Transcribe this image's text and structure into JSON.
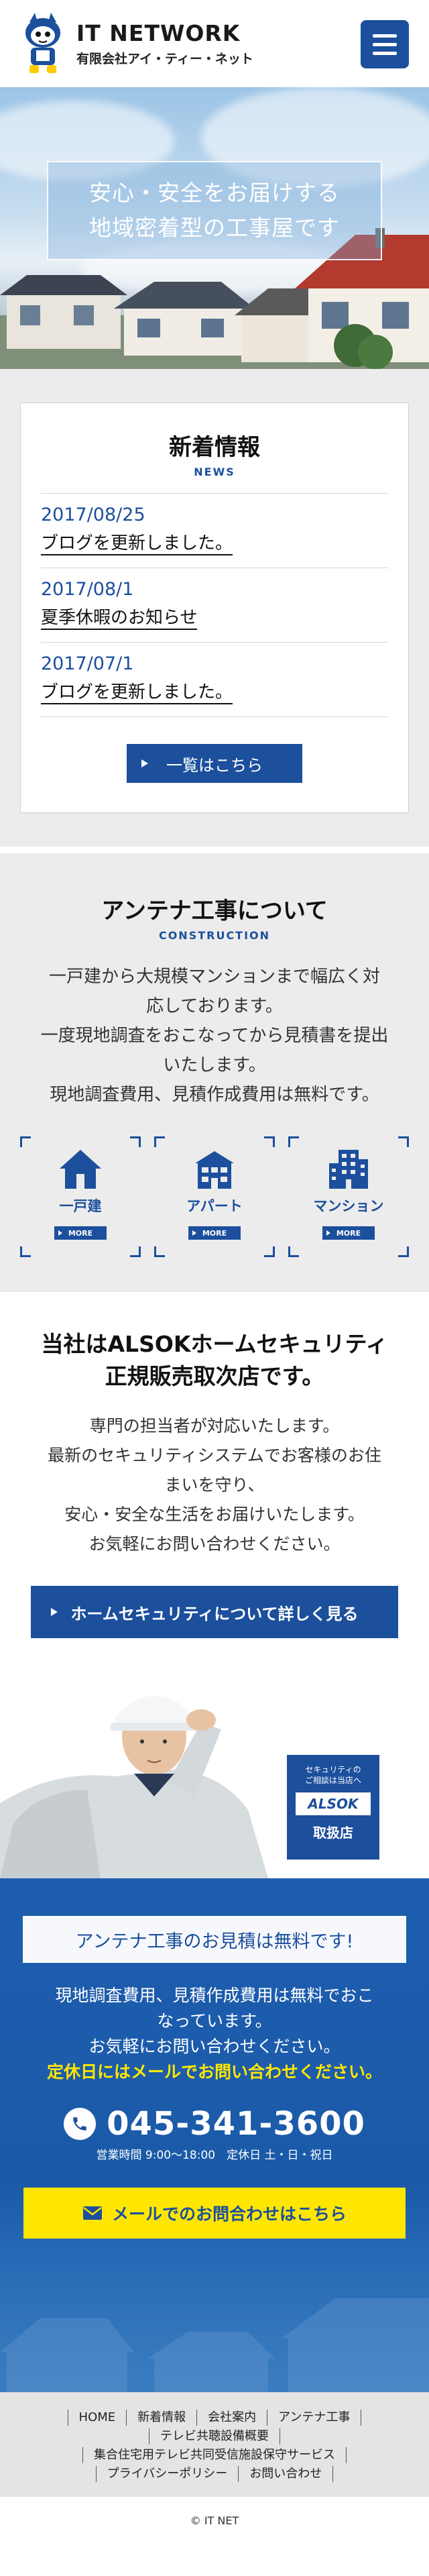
{
  "header": {
    "title": "IT NETWORK",
    "company": "有限会社アイ・ティー・ネット",
    "menu_icon": "hamburger-menu-icon"
  },
  "hero": {
    "line1": "安心・安全をお届けする",
    "line2": "地域密着型の工事屋です"
  },
  "news": {
    "title": "新着情報",
    "subtitle": "NEWS",
    "items": [
      {
        "date": "2017/08/25",
        "text": "ブログを更新しました。"
      },
      {
        "date": "2017/08/1",
        "text": "夏季休暇のお知らせ"
      },
      {
        "date": "2017/07/1",
        "text": "ブログを更新しました。"
      }
    ],
    "button": "一覧はこちら"
  },
  "antenna": {
    "title": "アンテナ工事について",
    "subtitle": "CONSTRUCTION",
    "desc": [
      "一戸建から大規模マンションまで幅広く対",
      "応しております。",
      "一度現地調査をおこなってから見積書を提出",
      "いたします。",
      "現地調査費用、見積作成費用は無料です。"
    ],
    "categories": [
      {
        "label": "一戸建",
        "more": "MORE",
        "icon": "house-icon"
      },
      {
        "label": "アパート",
        "more": "MORE",
        "icon": "apartment-icon"
      },
      {
        "label": "マンション",
        "more": "MORE",
        "icon": "building-icon"
      }
    ]
  },
  "alsok": {
    "title1": "当社はALSOKホームセキュリティ",
    "title2": "正規販売取次店です。",
    "desc": [
      "専門の担当者が対応いたします。",
      "最新のセキュリティシステムでお客様のお住",
      "まいを守り、",
      "安心・安全な生活をお届けいたします。",
      "お気軽にお問い合わせください。"
    ],
    "button": "ホームセキュリティについて詳しく見る",
    "badge_top1": "セキュリティの",
    "badge_top2": "ご相談は当店へ",
    "badge_logo": "ALSOK",
    "badge_bottom": "取扱店"
  },
  "estimate": {
    "title": "アンテナ工事のお見積は無料です!",
    "desc": [
      "現地調査費用、見積作成費用は無料でおこ",
      "なっています。",
      "お気軽にお問い合わせください。"
    ],
    "desc_highlight": "定休日にはメールでお問い合わせください。",
    "phone": "045-341-3600",
    "hours": "営業時間 9:00～18:00　定休日 土・日・祝日",
    "mail_button": "メールでのお問合わせはこちら",
    "accent": "#ffe600"
  },
  "footer": {
    "nav_rows": [
      [
        "HOME",
        "新着情報",
        "会社案内",
        "アンテナ工事"
      ],
      [
        "テレビ共聴設備概要"
      ],
      [
        "集合住宅用テレビ共同受信施設保守サービス"
      ],
      [
        "プライバシーポリシー",
        "お問い合わせ"
      ]
    ],
    "copyright": "© IT NET"
  },
  "colors": {
    "brand": "#1c4f9c",
    "highlight": "#ffe600",
    "section_bg": "#ececec"
  }
}
